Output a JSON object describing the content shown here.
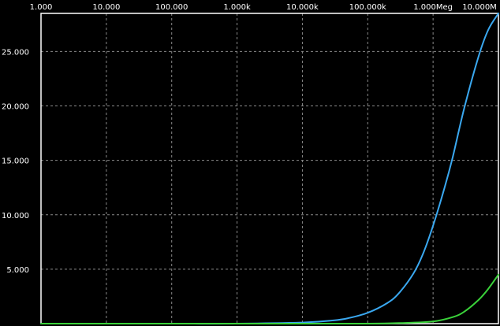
{
  "chart_data": {
    "type": "line",
    "title": "",
    "xlabel": "",
    "ylabel": "",
    "xscale": "log",
    "xlim": [
      1,
      10000000
    ],
    "ylim": [
      0,
      28.5
    ],
    "grid": true,
    "legend": "none",
    "background": "#000000",
    "grid_color": "#8a8a8a",
    "axis_color": "#ffffff",
    "x_ticks": [
      1,
      10,
      100,
      1000,
      10000,
      100000,
      1000000,
      10000000
    ],
    "x_tick_labels": [
      "1.000",
      "10.000",
      "100.000",
      "1.000k",
      "10.000k",
      "100.000k",
      "1.000Meg",
      "10.000M"
    ],
    "y_ticks": [
      5,
      10,
      15,
      20,
      25
    ],
    "y_tick_labels": [
      "5.000",
      "10.000",
      "15.000",
      "20.000",
      "25.000"
    ],
    "series": [
      {
        "color": "#3aa8f0",
        "x": [
          1,
          10,
          100,
          1000,
          10000,
          30000,
          50000,
          100000,
          200000,
          300000,
          500000,
          700000,
          1000000,
          1500000,
          2000000,
          3000000,
          5000000,
          7000000,
          10000000
        ],
        "y": [
          0.0,
          0.0,
          0.0,
          0.0,
          0.1,
          0.3,
          0.5,
          1.0,
          1.9,
          2.8,
          4.6,
          6.4,
          9.0,
          12.5,
          15.3,
          19.8,
          24.6,
          27.0,
          28.5
        ]
      },
      {
        "color": "#3ad23a",
        "x": [
          1,
          10,
          100,
          1000,
          10000,
          100000,
          300000,
          1000000,
          2000000,
          3000000,
          5000000,
          7000000,
          10000000
        ],
        "y": [
          0.0,
          0.0,
          0.0,
          0.0,
          0.0,
          0.0,
          0.05,
          0.2,
          0.6,
          1.1,
          2.2,
          3.2,
          4.5
        ]
      }
    ]
  }
}
